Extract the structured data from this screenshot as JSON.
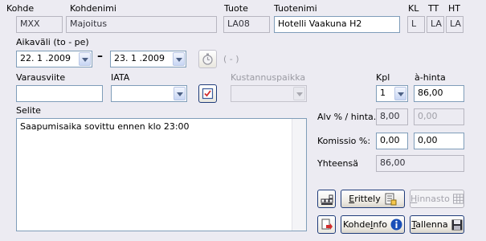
{
  "header": {
    "kohde_label": "Kohde",
    "kohde_value": "MXX",
    "kohdenimi_label": "Kohdenimi",
    "kohdenimi_value": "Majoitus",
    "tuote_label": "Tuote",
    "tuote_value": "LA08",
    "tuotenimi_label": "Tuotenimi",
    "tuotenimi_value": "Hotelli Vaakuna H2",
    "kl_label": "KL",
    "kl_value": "L",
    "tt_label": "TT",
    "tt_value": "LA",
    "ht_label": "HT",
    "ht_value": "LA"
  },
  "period": {
    "label": "Aikaväli (to - pe)",
    "start": "22. 1 .2009",
    "dash": "–",
    "end": "23. 1 .2009",
    "nights": "( - )"
  },
  "fields": {
    "varausviite_label": "Varausviite",
    "varausviite_value": "",
    "iata_label": "IATA",
    "iata_value": "",
    "kustannuspaikka_label": "Kustannuspaikka",
    "kustannuspaikka_value": ""
  },
  "pricing": {
    "kpl_label": "Kpl",
    "kpl_value": "1",
    "ahinta_label": "à-hinta",
    "ahinta_value": "86,00",
    "alv_label": "Alv % / hinta.",
    "alv_percent": "8,00",
    "alv_price": "0,00",
    "komissio_label": "Komissio %:",
    "komissio_percent": "0,00",
    "komissio_price": "0,00",
    "yhteensa_label": "Yhteensä",
    "yhteensa_value": "86,00"
  },
  "selite": {
    "label": "Selite",
    "text": "Saapumisaika sovittu ennen klo 23:00"
  },
  "buttons": {
    "erittely_first": "E",
    "erittely_rest": "rittely",
    "hinnasto_first": "H",
    "hinnasto_rest": "innasto",
    "kohdeinfo_pre": "Kohde",
    "kohdeinfo_u": "I",
    "kohdeinfo_post": "nfo",
    "tallenna_first": "T",
    "tallenna_rest": "allenna"
  },
  "icons": {
    "timer": "stopwatch-icon",
    "iata_pick": "checklist-icon",
    "grid": "grid-icon",
    "erittely": "document-detail-icon",
    "hinnasto": "table-icon",
    "export": "document-export-icon",
    "info": "info-icon",
    "save": "floppy-disk-icon"
  }
}
